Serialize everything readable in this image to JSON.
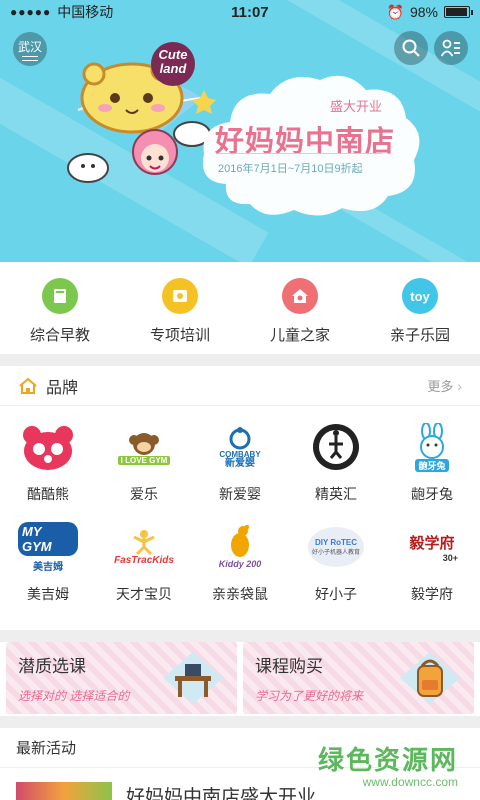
{
  "status_bar": {
    "signal": "●●●●●",
    "carrier": "中国移动",
    "time": "11:07",
    "battery": "98%",
    "battery_level": 0.98
  },
  "header": {
    "city": "武汉",
    "search_icon": "search-icon",
    "user_icon": "user-list-icon"
  },
  "banner": {
    "logo_text_1": "Cute",
    "logo_text_2": "land",
    "subtitle": "盛大开业",
    "title": "好妈妈中南店",
    "date": "2016年7月1日~7月10日9折起"
  },
  "categories": [
    {
      "label": "综合早教",
      "icon": "book-icon",
      "color": "#7cc84e"
    },
    {
      "label": "专项培训",
      "icon": "flower-icon",
      "color": "#f5c224"
    },
    {
      "label": "儿童之家",
      "icon": "house-icon",
      "color": "#ee6f74"
    },
    {
      "label": "亲子乐园",
      "icon": "toy-icon",
      "color": "#41c6e8",
      "icon_text": "toy"
    }
  ],
  "brands_section": {
    "title": "品牌",
    "more": "更多",
    "items": [
      {
        "label": "酷酷熊",
        "logo_color": "#e8365d"
      },
      {
        "label": "爱乐",
        "logo_text": "I LOVE GYM",
        "logo_color": "#8dc63f"
      },
      {
        "label": "新爱婴",
        "logo_text": "COMBABY",
        "logo_sub": "新爱婴",
        "logo_color": "#1b6fb5"
      },
      {
        "label": "精英汇",
        "logo_color": "#222222"
      },
      {
        "label": "龅牙兔",
        "logo_text": "龅牙兔",
        "logo_color": "#2aa7e0"
      },
      {
        "label": "美吉姆",
        "logo_text": "MY GYM",
        "logo_sub": "美吉姆",
        "logo_color": "#1a5ea8"
      },
      {
        "label": "天才宝贝",
        "logo_text": "FasTracKids",
        "logo_color": "#e53935"
      },
      {
        "label": "亲亲袋鼠",
        "logo_text": "Kiddy 200",
        "logo_color": "#f0a500"
      },
      {
        "label": "好小子",
        "logo_text": "DIY RoTEC",
        "logo_sub": "好小子机器人教育",
        "logo_color": "#3a7bd5"
      },
      {
        "label": "毅学府",
        "logo_text": "毅学府",
        "logo_sub": "30+",
        "logo_color": "#b71c1c"
      }
    ]
  },
  "promos": [
    {
      "title": "潜质选课",
      "subtitle": "选择对的 选择适合的"
    },
    {
      "title": "课程购买",
      "subtitle": "学习为了更好的将来"
    }
  ],
  "news": {
    "title": "最新活动",
    "first_item_title": "好妈妈中南店盛大开业"
  },
  "watermark": {
    "line1": "绿色资源网",
    "line2": "www.downcc.com"
  }
}
